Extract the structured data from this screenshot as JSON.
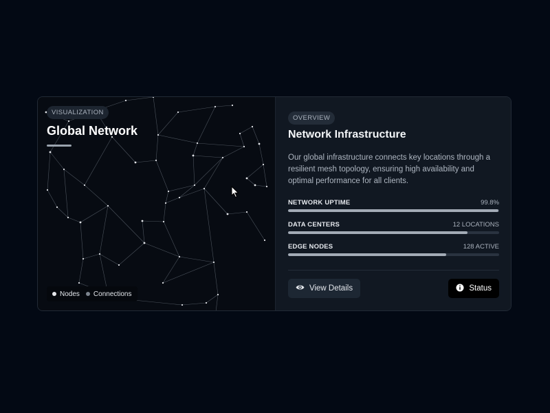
{
  "visualization": {
    "tag": "VISUALIZATION",
    "title": "Global Network",
    "legend": {
      "nodes_label": "Nodes",
      "connections_label": "Connections"
    }
  },
  "overview": {
    "tag": "OVERVIEW",
    "heading": "Network Infrastructure",
    "description": "Our global infrastructure connects key locations through a resilient mesh topology, ensuring high availability and optimal performance for all clients."
  },
  "metrics": [
    {
      "label": "NETWORK UPTIME",
      "value": "99.8%",
      "fill": 0.998
    },
    {
      "label": "DATA CENTERS",
      "value": "12 LOCATIONS",
      "fill": 0.85
    },
    {
      "label": "EDGE NODES",
      "value": "128 ACTIVE",
      "fill": 0.75
    }
  ],
  "actions": {
    "view_details_label": "View Details",
    "status_label": "Status"
  },
  "colors": {
    "background": "#030914",
    "card_left": "#070b12",
    "card_right": "#111822",
    "bar_fill": "#a3abb6",
    "bar_track": "#2a3340"
  },
  "icons": {
    "view_details": "eye-icon",
    "status": "info-icon",
    "pointer": "cursor-icon"
  }
}
